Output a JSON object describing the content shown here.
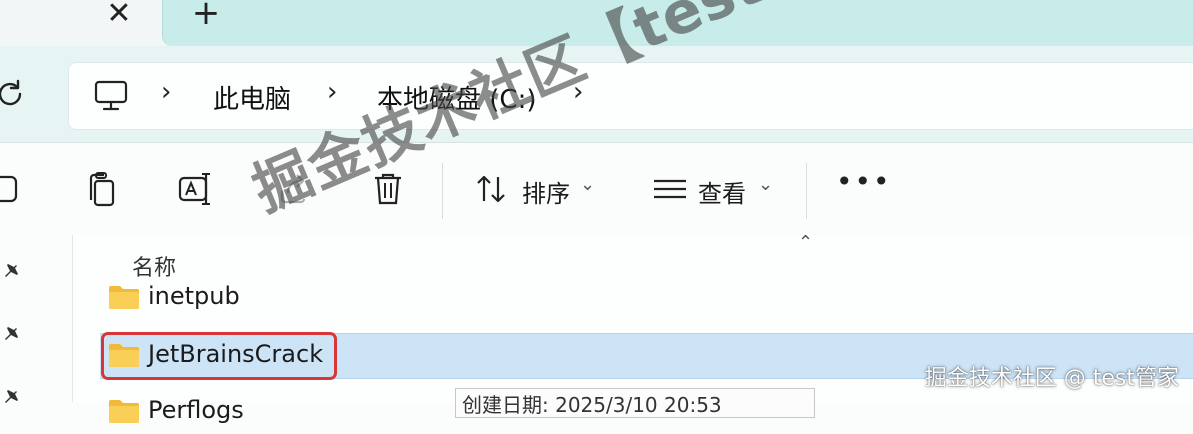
{
  "tabs": {
    "close_glyph": "✕",
    "new_tab_glyph": "+"
  },
  "breadcrumb": {
    "items": [
      "此电脑",
      "本地磁盘 (C:)"
    ],
    "separator": "›"
  },
  "toolbar": {
    "sort_label": "排序",
    "view_label": "查看",
    "more_label": "•••",
    "caret": "⌄"
  },
  "file_list": {
    "column_name": "名称",
    "sort_indicator": "⌃",
    "rows": [
      {
        "name": "inetpub",
        "selected": false
      },
      {
        "name": "JetBrainsCrack",
        "selected": true
      },
      {
        "name": "Perflogs",
        "selected": false
      }
    ],
    "tooltip_text": "创建日期: 2025/3/10 20:53"
  },
  "watermark": {
    "main": "掘金技术社区【test管家】",
    "corner": "掘金技术社区 @ test管家"
  },
  "colors": {
    "accent_tab": "#c7ecea",
    "address_row": "#e6f5f4",
    "selection": "#cce4f6",
    "highlight_box": "#d9363a",
    "folder": "#f7c84a"
  },
  "icons": [
    "close-icon",
    "plus-icon",
    "refresh-icon",
    "this-pc-icon",
    "chevron-right-icon",
    "cut-icon",
    "copy-icon",
    "rename-icon",
    "share-icon",
    "delete-icon",
    "sort-icon",
    "view-icon",
    "more-icon",
    "pin-icon",
    "folder-icon"
  ]
}
